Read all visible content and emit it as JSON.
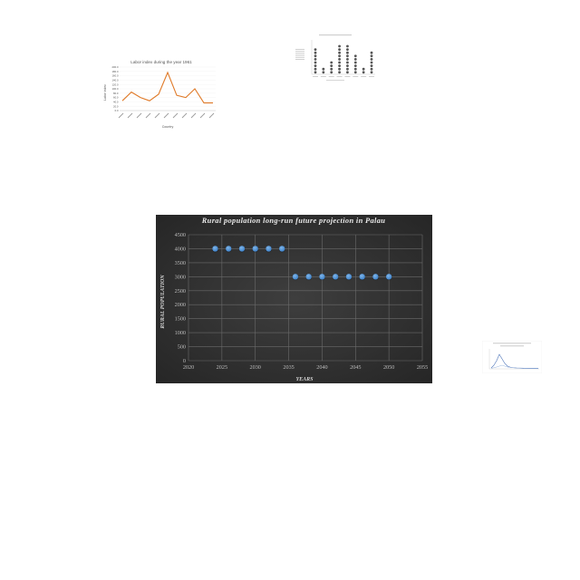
{
  "chart_data": [
    {
      "type": "scatter",
      "title": "Rural population long-run future projection in Palau",
      "xlabel": "YEARS",
      "ylabel": "RURAL POPULATION",
      "xlim": [
        2020,
        2055
      ],
      "ylim": [
        0,
        4500
      ],
      "x_ticks": [
        "2020",
        "2025",
        "2030",
        "2035",
        "2040",
        "2045",
        "2050",
        "2055"
      ],
      "y_ticks": [
        "0",
        "500",
        "1000",
        "1500",
        "2000",
        "2500",
        "3000",
        "3500",
        "4000",
        "4500"
      ],
      "grid": true,
      "series": [
        {
          "x": [
            2024,
            2026,
            2028,
            2030,
            2032,
            2034,
            2036,
            2038,
            2040,
            2042,
            2044,
            2046,
            2048,
            2050
          ],
          "y": [
            4000,
            4000,
            4000,
            4000,
            4000,
            4000,
            3000,
            3000,
            3000,
            3000,
            3000,
            3000,
            3000,
            3000
          ]
        }
      ],
      "colors": {
        "background": "#2f2f2f",
        "marker": "#4a90d9",
        "grid": "#6b6b6b"
      }
    },
    {
      "type": "line",
      "title": "Labor index during the year 1961",
      "xlabel": "Country",
      "ylabel": "Labor index",
      "ylim": [
        0,
        200
      ],
      "y_ticks": [
        "0.0",
        "20.0",
        "40.0",
        "60.0",
        "80.0",
        "100.0",
        "120.0",
        "140.0",
        "160.0",
        "180.0",
        "200.0"
      ],
      "categories": [
        "",
        "",
        "",
        "",
        "",
        "",
        "",
        "",
        "",
        "",
        ""
      ],
      "values": [
        45,
        85,
        60,
        45,
        75,
        175,
        70,
        60,
        100,
        35,
        35
      ],
      "colors": {
        "line": "#e07b2a"
      }
    },
    {
      "type": "scatter",
      "title": "",
      "categories": [
        "",
        "",
        "",
        "",
        "",
        "",
        "",
        ""
      ],
      "values": [
        8,
        2,
        4,
        9,
        9,
        6,
        2,
        7
      ],
      "colors": {
        "marker": "#555555"
      }
    },
    {
      "type": "line",
      "title": "",
      "colors": {
        "line": "#4a72b8"
      }
    }
  ]
}
